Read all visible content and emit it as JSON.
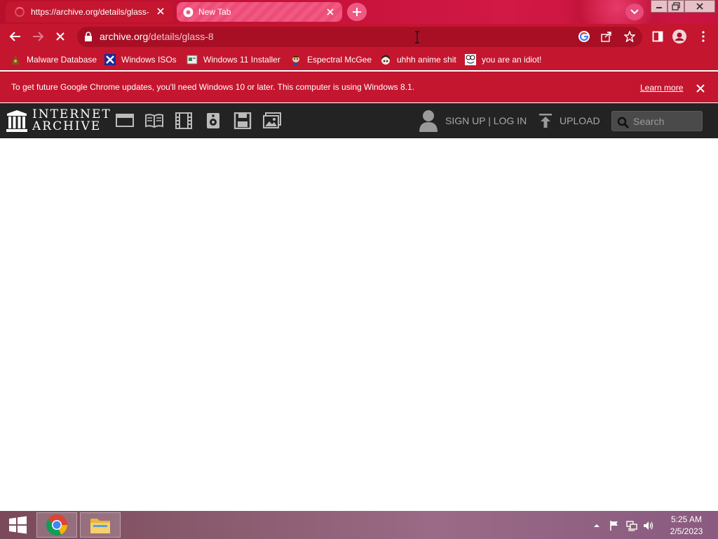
{
  "browser": {
    "tabs": [
      {
        "title": "https://archive.org/details/glass-",
        "state": "loading",
        "icon": "loading-spinner-icon"
      },
      {
        "title": "New Tab",
        "icon": "chrome-icon"
      }
    ],
    "url": {
      "host": "archive.org",
      "path": "/details/glass-8"
    },
    "colors": {
      "theme": "#c4162f",
      "omnibox": "#a80f25"
    }
  },
  "bookmarks": [
    {
      "label": "Malware Database",
      "icon": "malware-icon"
    },
    {
      "label": "Windows ISOs",
      "icon": "x-icon"
    },
    {
      "label": "Windows 11 Installer",
      "icon": "installer-icon"
    },
    {
      "label": "Espectral McGee",
      "icon": "avatar-icon"
    },
    {
      "label": "uhhh anime shit",
      "icon": "anime-icon"
    },
    {
      "label": "you are an idiot!",
      "icon": "smiley-icon"
    }
  ],
  "infobar": {
    "message": "To get future Google Chrome updates, you'll need Windows 10 or later. This computer is using Windows 8.1.",
    "link": "Learn more"
  },
  "archive_nav": {
    "logo_line1": "INTERNET",
    "logo_line2": "ARCHIVE",
    "media_icons": [
      "web-icon",
      "texts-icon",
      "video-icon",
      "audio-icon",
      "software-icon",
      "images-icon"
    ],
    "signup_login": "SIGN UP | LOG IN",
    "upload": "UPLOAD",
    "search_placeholder": "Search"
  },
  "taskbar": {
    "time": "5:25 AM",
    "date": "2/5/2023"
  }
}
